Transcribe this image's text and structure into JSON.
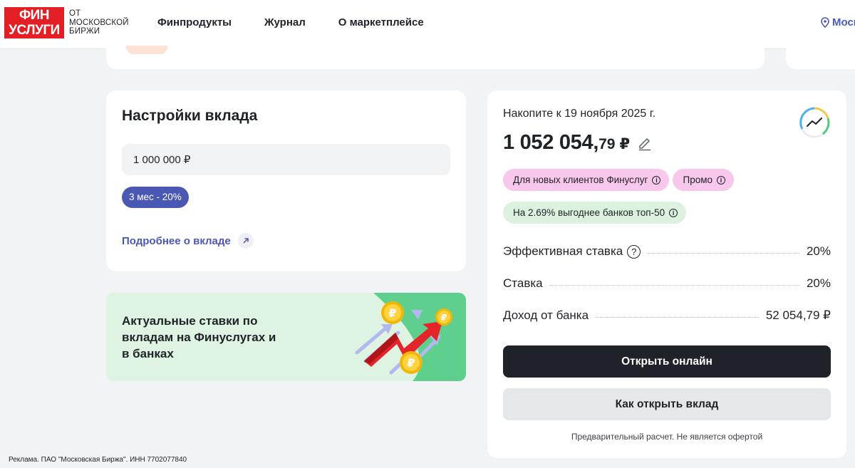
{
  "header": {
    "logo_line1": "ФИН",
    "logo_line2": "УСЛУГИ",
    "logo_sub1": "ОТ",
    "logo_sub2": "МОСКОВСКОЙ",
    "logo_sub3": "БИРЖИ",
    "nav": [
      "Финпродукты",
      "Журнал",
      "О маркетплейсе"
    ],
    "city": "Моск"
  },
  "settings": {
    "title": "Настройки вклада",
    "amount": "1 000 000 ₽",
    "term_chip": "3 мес - 20%",
    "more_link": "Подробнее о вкладе"
  },
  "promo": {
    "text": "Актуальные ставки по вкладам на Финуслугах и в банках",
    "coin_symbol": "₽"
  },
  "calc": {
    "accumulate_label": "Накопите к 19 ноября 2025 г.",
    "sum_main": "1 052 054,",
    "sum_kop": "79",
    "currency": "₽",
    "tags": [
      "Для новых клиентов Финуслуг",
      "Промо"
    ],
    "compare_tag": "На 2.69% выгоднее банков топ-50",
    "rows": [
      {
        "label": "Эффективная ставка",
        "value": "20%"
      },
      {
        "label": "Ставка",
        "value": "20%"
      },
      {
        "label": "Доход от банка",
        "value": "52 054,79 ₽"
      }
    ],
    "open_online": "Открыть онлайн",
    "how_to_open": "Как открыть вклад",
    "disclaimer": "Предварительный расчет. Не является офертой"
  },
  "footer_note": "Реклама. ПАО \"Московская Биржа\". ИНН 7702077840",
  "colors": {
    "brand_red": "#e31e24",
    "accent_blue": "#4b58b3",
    "dark": "#1f2229",
    "tag_pink": "#f7c7ec",
    "tag_green": "#ddf1df",
    "promo_bg": "#dff3e2"
  },
  "icons": {
    "geo": "location-pin-icon",
    "edit": "pencil-icon",
    "trend": "trend-chart-icon",
    "info": "info-icon",
    "question": "question-icon",
    "arrow": "arrow-up-right-icon"
  }
}
